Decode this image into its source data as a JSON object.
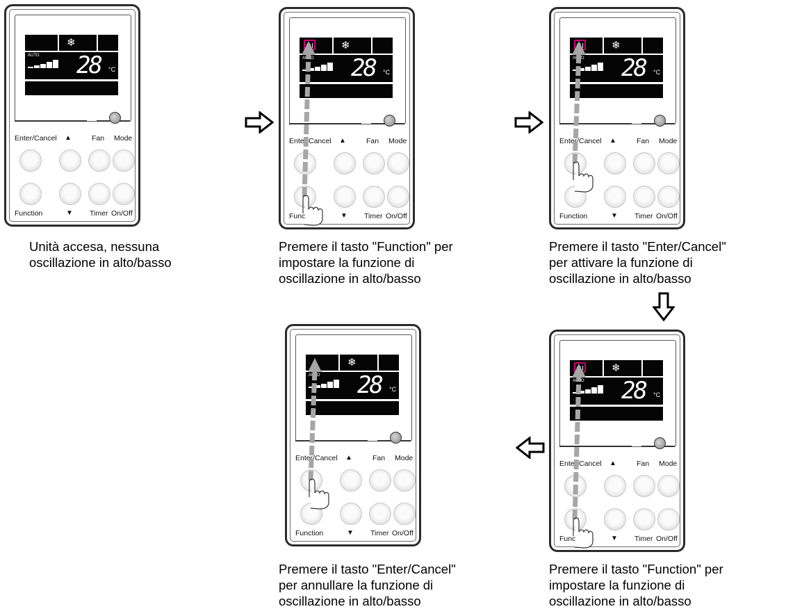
{
  "panel": {
    "temperature": "28",
    "unit": "°C",
    "auto_text": "AUTO",
    "swing_symbol": "≋I",
    "mode_symbol": "❄",
    "buttons": {
      "enter_cancel": "Enter/Cancel",
      "up": "▲",
      "fan": "Fan",
      "mode": "Mode",
      "function": "Function",
      "down": "▼",
      "timer": "Timer",
      "on_off": "On/Off"
    }
  },
  "steps": [
    {
      "caption_lines": [
        "Unità accesa, nessuna",
        "oscillazione in alto/basso"
      ],
      "swing_highlight": false,
      "pressed": "none"
    },
    {
      "caption_lines": [
        "Premere il tasto \"Function\" per",
        "impostare la funzione di",
        "oscillazione in alto/basso"
      ],
      "swing_highlight": true,
      "pressed": "function"
    },
    {
      "caption_lines": [
        "Premere il tasto \"Enter/Cancel\"",
        "per attivare la funzione di",
        "oscillazione in alto/basso"
      ],
      "swing_highlight": true,
      "pressed": "enter_cancel"
    },
    {
      "caption_lines": [
        "Premere il tasto \"Function\" per",
        "impostare la funzione di",
        "oscillazione in alto/basso"
      ],
      "swing_highlight": true,
      "pressed": "function"
    },
    {
      "caption_lines": [
        "Premere il tasto \"Enter/Cancel\"",
        "per annullare la funzione di",
        "oscillazione in alto/basso"
      ],
      "swing_highlight": false,
      "pressed": "enter_cancel"
    }
  ],
  "colors": {
    "swing_highlight": "#d1007a",
    "flow_arrow": "#ffffff",
    "guide_arrow": "#a6a6a6"
  },
  "icons": {
    "flow_arrow": "hollow-arrow-icon",
    "hand": "pointing-hand-icon",
    "led": "indicator-light-icon"
  }
}
